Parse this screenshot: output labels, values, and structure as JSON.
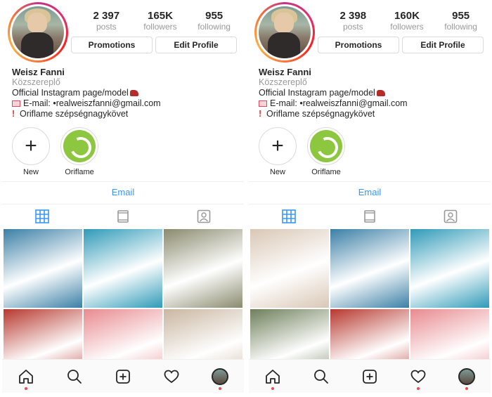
{
  "panels": [
    {
      "stats": {
        "posts_num": "2 397",
        "posts_lbl": "posts",
        "followers_num": "165K",
        "followers_lbl": "followers",
        "following_num": "955",
        "following_lbl": "following"
      },
      "buttons": {
        "promotions": "Promotions",
        "edit_profile": "Edit Profile"
      },
      "bio": {
        "name": "Weisz Fanni",
        "category": "Közszereplő",
        "line1": "Official Instagram page/model",
        "line2": "E-mail: •realweiszfanni@gmail.com",
        "line3": "Oriflame szépségnagykövet"
      },
      "highlights": {
        "new_label": "New",
        "oriflame_label": "Oriflame"
      },
      "email_label": "Email",
      "tiles": [
        "#3b7fa6",
        "#2f9ab8",
        "#8a8a6e",
        "#b7382f",
        "#e88a8f",
        "#c9b6a0"
      ]
    },
    {
      "stats": {
        "posts_num": "2 398",
        "posts_lbl": "posts",
        "followers_num": "160K",
        "followers_lbl": "followers",
        "following_num": "955",
        "following_lbl": "following"
      },
      "buttons": {
        "promotions": "Promotions",
        "edit_profile": "Edit Profile"
      },
      "bio": {
        "name": "Weisz Fanni",
        "category": "Közszereplő",
        "line1": "Official Instagram page/model",
        "line2": "E-mail: •realweiszfanni@gmail.com",
        "line3": "Oriflame szépségnagykövet"
      },
      "highlights": {
        "new_label": "New",
        "oriflame_label": "Oriflame"
      },
      "email_label": "Email",
      "tiles": [
        "#d9c7b5",
        "#3b7fa6",
        "#2f9ab8",
        "#6e7f5a",
        "#b7382f",
        "#e88a8f"
      ]
    }
  ],
  "colors": {
    "accent": "#3897f0",
    "ring": "#e1306c",
    "oriflame": "#8dc63f",
    "notification": "#ed4956"
  },
  "icons": {
    "tabs": [
      "grid-icon",
      "feed-icon",
      "tagged-icon"
    ],
    "nav": [
      "home-icon",
      "search-icon",
      "add-icon",
      "heart-icon",
      "profile-avatar"
    ]
  }
}
